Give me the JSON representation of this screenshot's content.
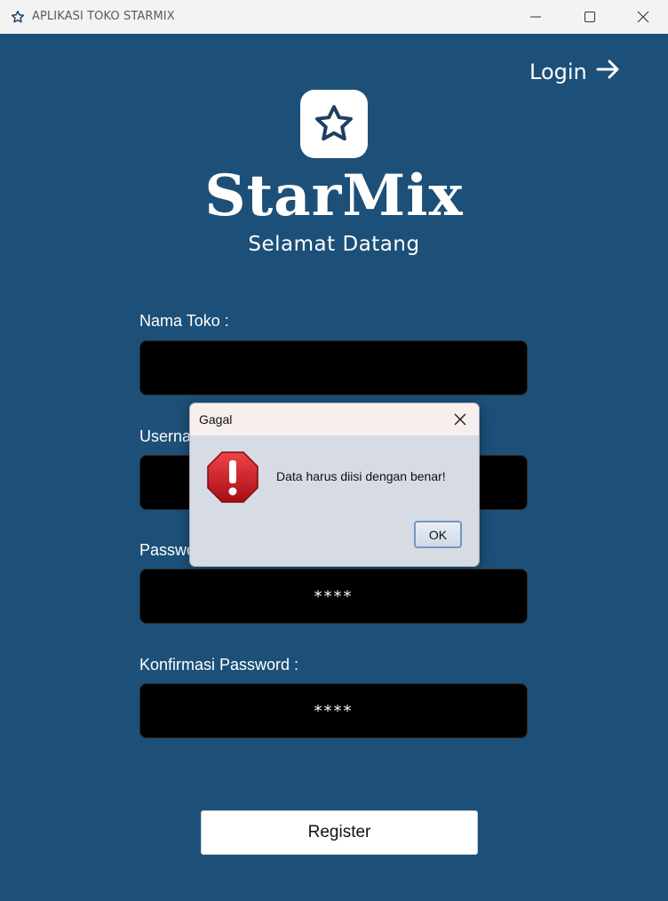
{
  "window": {
    "title": "APLIKASI TOKO STARMIX",
    "icon": "star-icon"
  },
  "header": {
    "login_label": "Login",
    "login_icon": "arrow-right-icon"
  },
  "branding": {
    "logo_icon": "star-icon",
    "name": "StarMix",
    "welcome": "Selamat Datang"
  },
  "form": {
    "store_name_label": "Nama Toko :",
    "store_name_value": "",
    "username_label": "Username :",
    "username_value": "",
    "password_label": "Password :",
    "password_value": "****",
    "confirm_password_label": "Konfirmasi Password :",
    "confirm_password_value": "****",
    "register_label": "Register"
  },
  "dialog": {
    "title": "Gagal",
    "message": "Data harus diisi dengan benar!",
    "ok_label": "OK",
    "icon": "error-icon"
  },
  "colors": {
    "background": "#1c5078",
    "input_background": "#000000",
    "dialog_background": "#d6dbe4",
    "error_red": "#c8161d"
  }
}
